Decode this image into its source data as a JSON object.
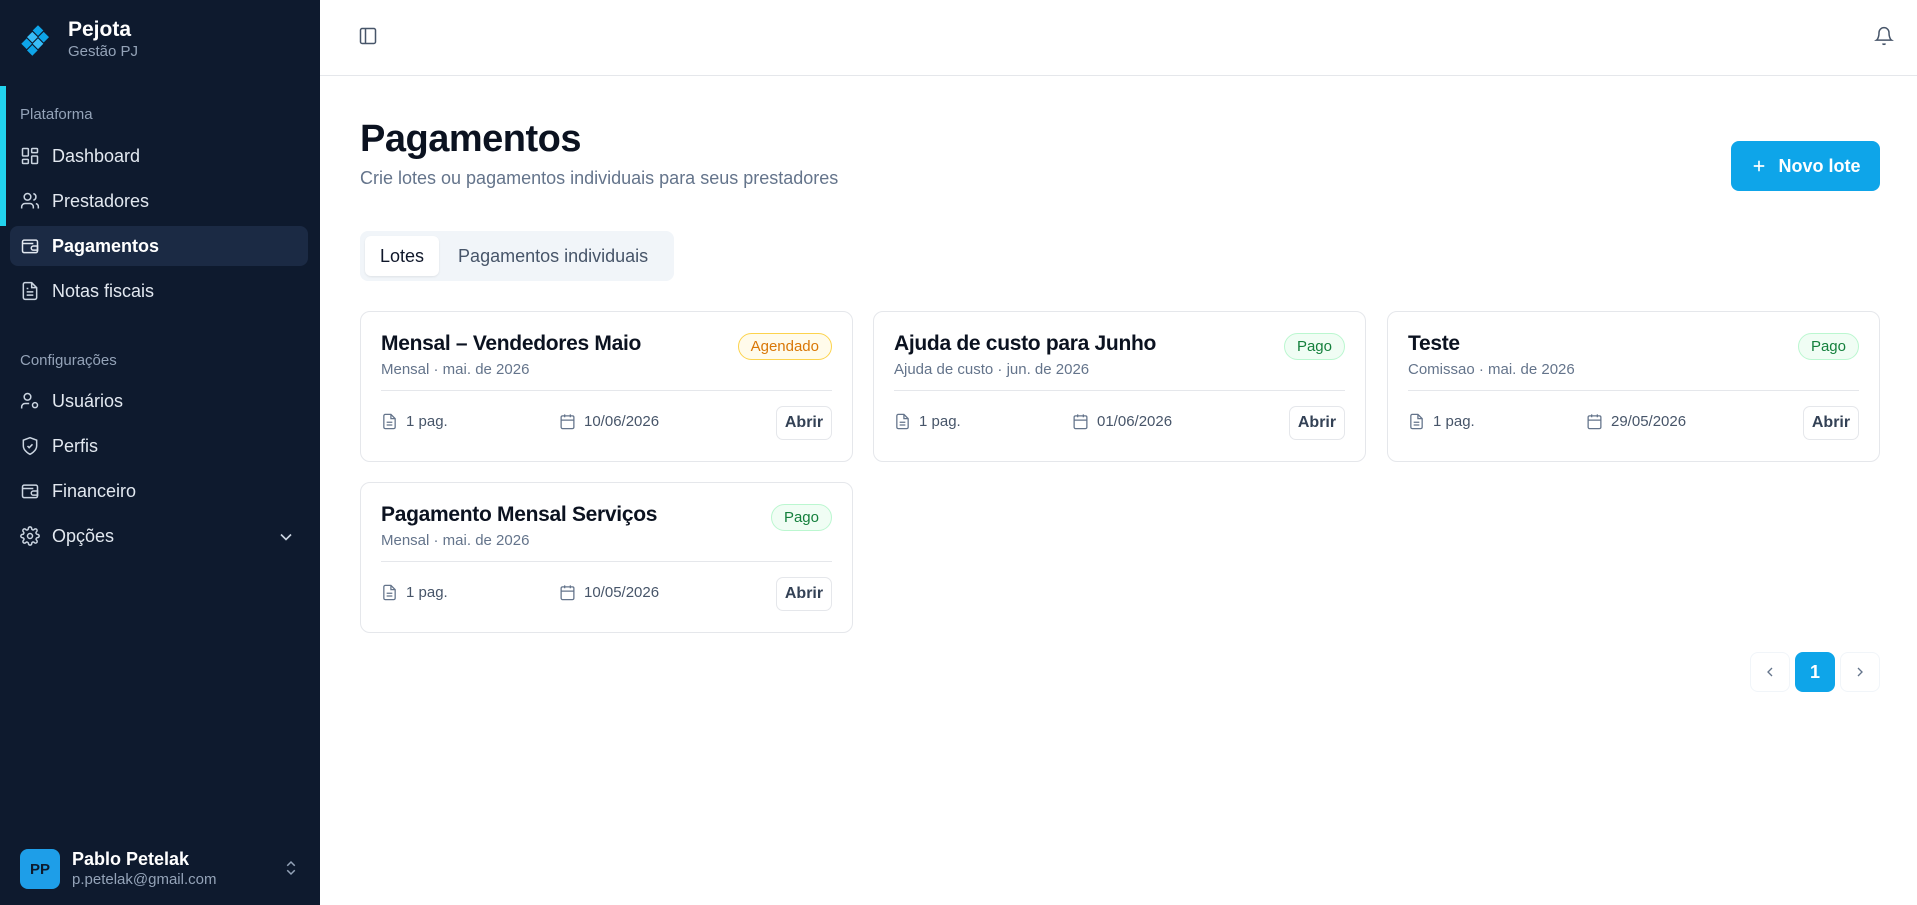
{
  "brand": {
    "name": "Pejota",
    "subtitle": "Gestão PJ",
    "icon": "diamond-grid-logo"
  },
  "sidebar": {
    "section_platform": "Plataforma",
    "platform_items": [
      {
        "label": "Dashboard",
        "icon": "layout-dashboard-icon"
      },
      {
        "label": "Prestadores",
        "icon": "users-icon"
      },
      {
        "label": "Pagamentos",
        "icon": "wallet-icon",
        "active": true
      },
      {
        "label": "Notas fiscais",
        "icon": "file-text-icon"
      }
    ],
    "section_config": "Configurações",
    "config_items": [
      {
        "label": "Usuários",
        "icon": "user-cog-icon"
      },
      {
        "label": "Perfis",
        "icon": "shield-icon"
      },
      {
        "label": "Financeiro",
        "icon": "wallet-icon"
      },
      {
        "label": "Opções",
        "icon": "gear-icon"
      }
    ]
  },
  "user": {
    "initials": "PP",
    "name": "Pablo Petelak",
    "email": "p.petelak@gmail.com"
  },
  "page": {
    "title": "Pagamentos",
    "subtitle": "Crie lotes ou pagamentos individuais para seus prestadores",
    "new_button": "Novo lote"
  },
  "tabs": [
    {
      "label": "Lotes",
      "active": true
    },
    {
      "label": "Pagamentos individuais",
      "active": false
    }
  ],
  "cards": [
    {
      "title": "Mensal – Vendedores Maio",
      "subtitle": "Mensal · mai. de 2026",
      "status": "Agendado",
      "count": "1 pag.",
      "date": "10/06/2026",
      "action": "Abrir"
    },
    {
      "title": "Ajuda de custo para Junho",
      "subtitle": "Ajuda de custo · jun. de 2026",
      "status": "Pago",
      "count": "1 pag.",
      "date": "01/06/2026",
      "action": "Abrir"
    },
    {
      "title": "Teste",
      "subtitle": "Comissao · mai. de 2026",
      "status": "Pago",
      "count": "1 pag.",
      "date": "29/05/2026",
      "action": "Abrir"
    },
    {
      "title": "Pagamento Mensal Serviços",
      "subtitle": "Mensal · mai. de 2026",
      "status": "Pago",
      "count": "1 pag.",
      "date": "10/05/2026",
      "action": "Abrir"
    }
  ],
  "pagination": {
    "current_page": "1"
  },
  "colors": {
    "sidebar_bg": "#0e1a2e",
    "accent": "#0ea5e9",
    "accent_bar": "#22d3ee",
    "scheduled": "#d97706",
    "paid": "#15803d"
  }
}
